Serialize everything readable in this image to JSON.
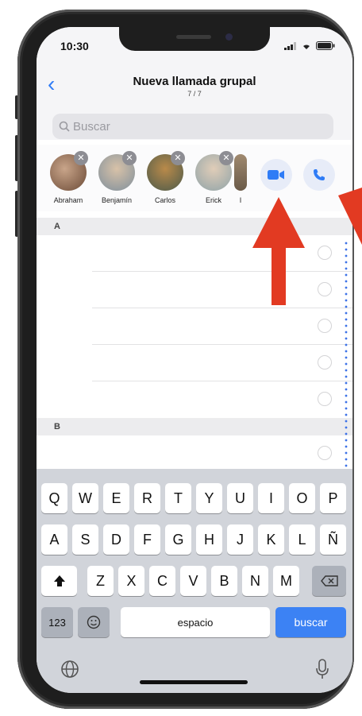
{
  "status": {
    "time": "10:30"
  },
  "header": {
    "back_label": "‹",
    "title": "Nueva llamada grupal",
    "subtitle": "7 / 7"
  },
  "search": {
    "placeholder": "Buscar"
  },
  "selected_contacts": [
    {
      "name": "Abraham",
      "color": "#8a6a52"
    },
    {
      "name": "Benjamín",
      "color": "#9aa7b2"
    },
    {
      "name": "Carlos",
      "color": "#7a6a3a"
    },
    {
      "name": "Erick",
      "color": "#a8b4b8"
    },
    {
      "name": "I",
      "color": "#8b7a68"
    }
  ],
  "call_buttons": {
    "video_icon": "video-camera-icon",
    "audio_icon": "phone-icon",
    "accent": "#2f7cf6"
  },
  "sections": [
    {
      "letter": "A"
    },
    {
      "letter": "B"
    }
  ],
  "keyboard": {
    "row1": [
      "Q",
      "W",
      "E",
      "R",
      "T",
      "Y",
      "U",
      "I",
      "O",
      "P"
    ],
    "row2": [
      "A",
      "S",
      "D",
      "F",
      "G",
      "H",
      "J",
      "K",
      "L",
      "Ñ"
    ],
    "row3": [
      "Z",
      "X",
      "C",
      "V",
      "B",
      "N",
      "M"
    ],
    "numbers_key": "123",
    "space_key": "espacio",
    "search_key": "buscar"
  },
  "annotation_color": "#e23a22"
}
